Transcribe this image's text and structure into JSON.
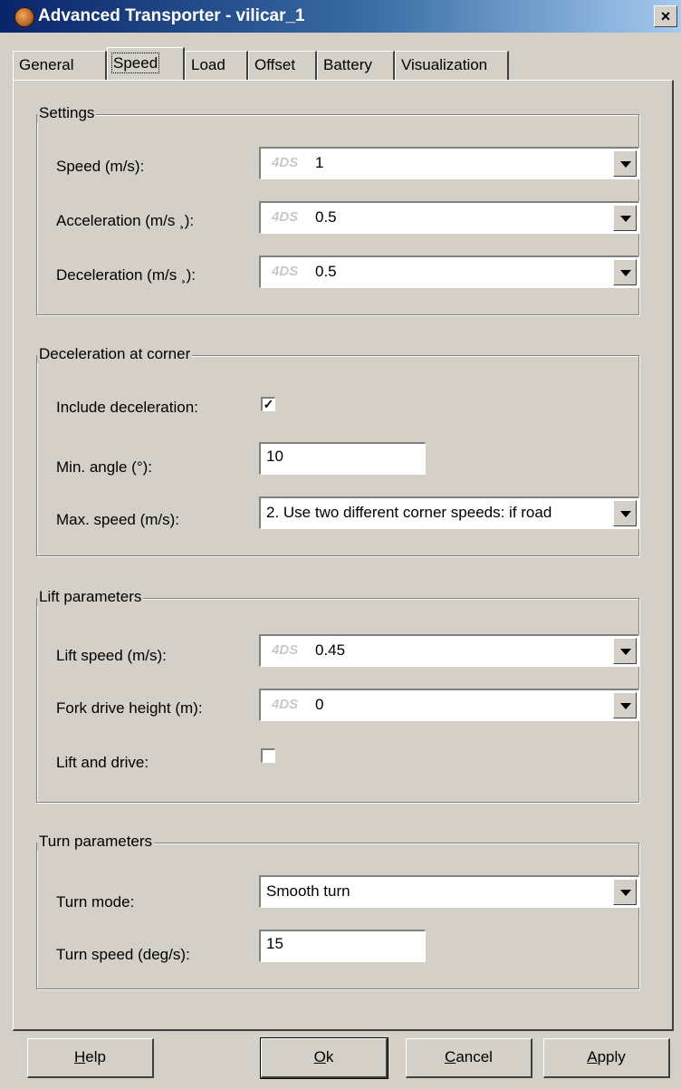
{
  "window": {
    "title": "Advanced Transporter - vilicar_1",
    "close_label": "×"
  },
  "tabs": [
    "General",
    "Speed",
    "Load",
    "Offset",
    "Battery",
    "Visualization"
  ],
  "active_tab": "Speed",
  "settings": {
    "title": "Settings",
    "speed_label": "Speed (m/s):",
    "speed_tag": "4DS",
    "speed_value": "1",
    "accel_label": "Acceleration (m/s ¸):",
    "accel_tag": "4DS",
    "accel_value": "0.5",
    "decel_label": "Deceleration (m/s ¸):",
    "decel_tag": "4DS",
    "decel_value": "0.5"
  },
  "corner": {
    "title": "Deceleration at corner",
    "include_label": "Include deceleration:",
    "include_checked": "✓",
    "min_angle_label": "Min. angle (°):",
    "min_angle_value": "10",
    "max_speed_label": "Max. speed (m/s):",
    "max_speed_value": "2. Use two different corner speeds: if road"
  },
  "lift": {
    "title": "Lift parameters",
    "lift_speed_label": "Lift speed (m/s):",
    "lift_speed_tag": "4DS",
    "lift_speed_value": "0.45",
    "fork_label": "Fork drive height (m):",
    "fork_tag": "4DS",
    "fork_value": "0",
    "lift_drive_label": "Lift and drive:",
    "lift_drive_checked": ""
  },
  "turn": {
    "title": "Turn parameters",
    "mode_label": "Turn mode:",
    "mode_value": "Smooth turn",
    "speed_label": "Turn speed (deg/s):",
    "speed_value": "15"
  },
  "buttons": {
    "help_mn": "H",
    "help_rest": "elp",
    "ok_mn": "O",
    "ok_rest": "k",
    "cancel_mn": "C",
    "cancel_rest": "ancel",
    "apply_mn": "A",
    "apply_rest": "pply"
  }
}
